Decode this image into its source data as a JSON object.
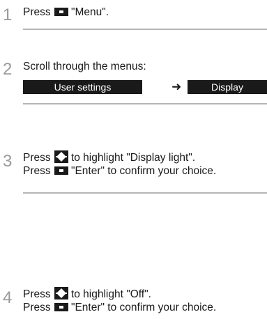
{
  "steps": [
    {
      "number": "1",
      "lines": [
        {
          "before": "Press",
          "icon": "menu-key-icon",
          "after": "\"Menu\"."
        }
      ]
    },
    {
      "number": "2",
      "lines": [
        {
          "before": "Scroll through the menus:"
        }
      ],
      "menu_path": [
        "User settings",
        "Display"
      ]
    },
    {
      "number": "3",
      "lines": [
        {
          "before": "Press",
          "icon": "up-down-arrow-icon",
          "after": "to highlight \"Display light\"."
        },
        {
          "before": "Press",
          "icon": "menu-key-icon",
          "after": "\"Enter\" to confirm your choice."
        }
      ]
    },
    {
      "number": "4",
      "lines": [
        {
          "before": "Press",
          "icon": "up-down-arrow-icon",
          "after": "to highlight \"Off\"."
        },
        {
          "before": "Press",
          "icon": "menu-key-icon",
          "after": "\"Enter\" to confirm your choice."
        }
      ]
    }
  ],
  "colors": {
    "text": "#1a1a1a",
    "step_number": "#9a9a9a",
    "rule": "#b5b5b5",
    "menu_box": "#1a1a1a"
  }
}
